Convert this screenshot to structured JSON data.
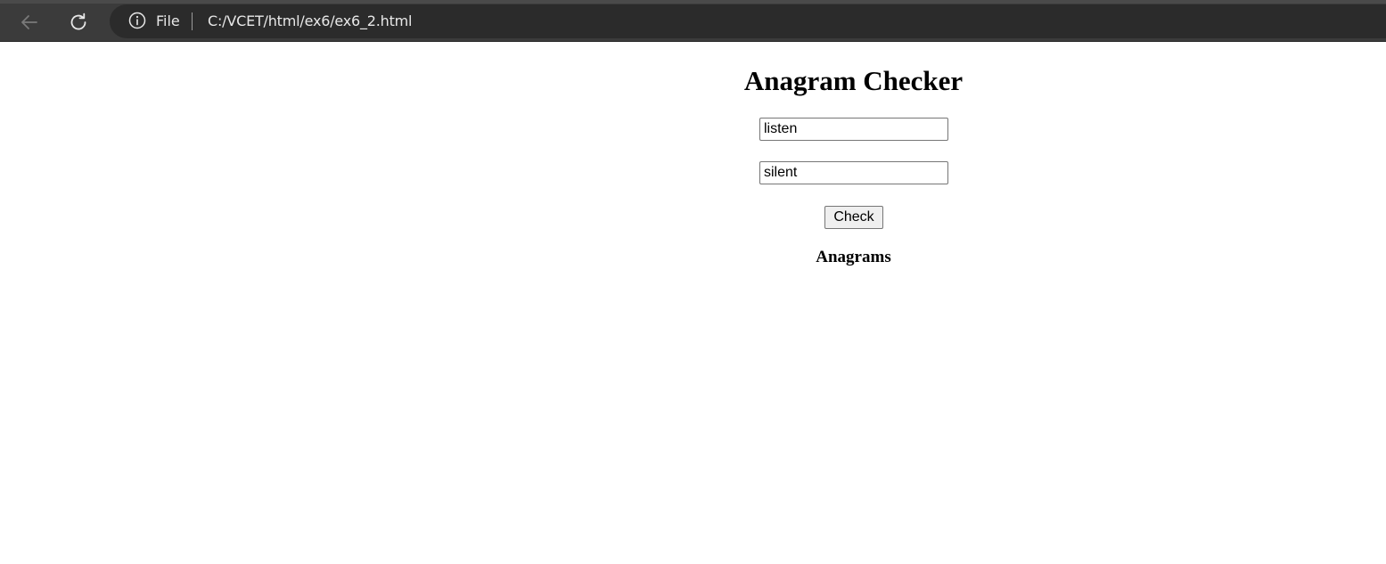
{
  "browser": {
    "scheme_label": "File",
    "url": "C:/VCET/html/ex6/ex6_2.html",
    "icons": {
      "back": "arrow-left-icon",
      "reload": "reload-icon",
      "info": "info-icon"
    }
  },
  "page": {
    "title": "Anagram Checker",
    "word1": {
      "value": "listen"
    },
    "word2": {
      "value": "silent"
    },
    "check_label": "Check",
    "result": "Anagrams"
  }
}
